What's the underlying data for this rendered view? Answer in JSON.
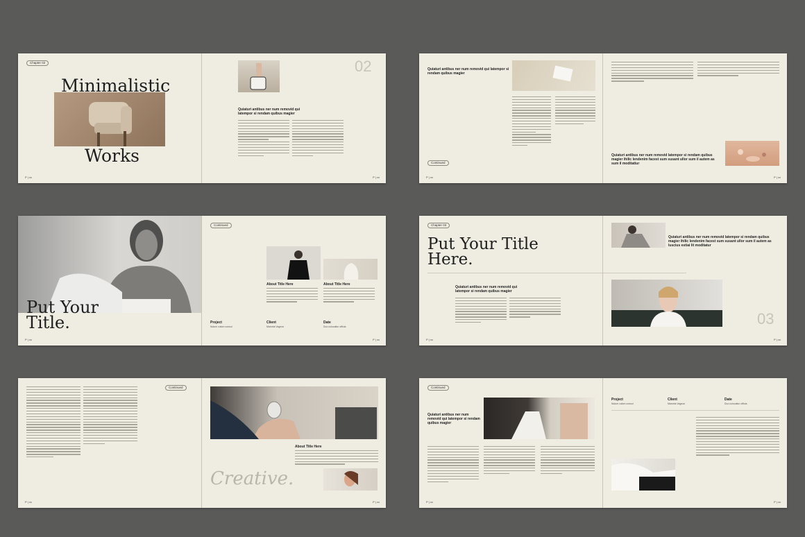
{
  "colors": {
    "background": "#5a5a59",
    "paper": "#efede2",
    "text": "#1e1e1e",
    "page_number": "#c7c4ba"
  },
  "spread1": {
    "chapter": "Chapter 02",
    "title_line1": "Minimalistic",
    "title_line2": "Works",
    "page_number": "02",
    "heading": "Quiaturi antibus ner num removid qui latempor si rendam quibus magier",
    "folio_left": "P | xx",
    "folio_right": "P | xx"
  },
  "spread2": {
    "heading": "Quiaturi antibus ner num removid qui latempor si rendam quibus magier",
    "continued": "Continued",
    "heading2": "Quiaturi antibus ner num removid latempor si rendam quibus magier ihilic lendenim facest sum susant ullor sum il autem as sum il moditatiur",
    "folio_left": "P | xx",
    "folio_right": "P | xx"
  },
  "spread3": {
    "title_line1": "Put Your",
    "title_line2": "Title.",
    "continued": "Continued",
    "about1": "About Title Here",
    "about2": "About Title Here",
    "project": "Project",
    "project_sub": "Nulum culum consul",
    "client": "Client",
    "client_sub": "Marcela Vagnon",
    "date": "Date",
    "date_sub": "Duo culocatiur officia",
    "folio_left": "P | xx",
    "folio_right": "P | xx"
  },
  "spread4": {
    "chapter": "Chapter 03",
    "title_line1": "Put Your Title",
    "title_line2": "Here.",
    "heading": "Quiaturi antibus ner num removid qui latempor si rendam quibus magier",
    "heading2": "Quiaturi antibus ner num removid latempor si rendam quibus magier ihilic lendenim facest sum susant ullor sum il autem as luscius estiai lit moditatur",
    "page_number": "03",
    "folio_left": "P | xx",
    "folio_right": "P | xx"
  },
  "spread5": {
    "continued": "Continued",
    "about": "About Title Here",
    "script": "Creative.",
    "folio_left": "P | xx",
    "folio_right": "P | xx"
  },
  "spread6": {
    "continued": "Continued",
    "heading": "Quiaturi antibus ner num removid qui latempor si rendam quibus magier",
    "project": "Project",
    "project_sub": "Nulum culum consul",
    "client": "Client",
    "client_sub": "Marcela Vagnon",
    "date": "Date",
    "date_sub": "Duo culocatiur officia",
    "folio_left": "P | xx",
    "folio_right": "P | xx"
  }
}
